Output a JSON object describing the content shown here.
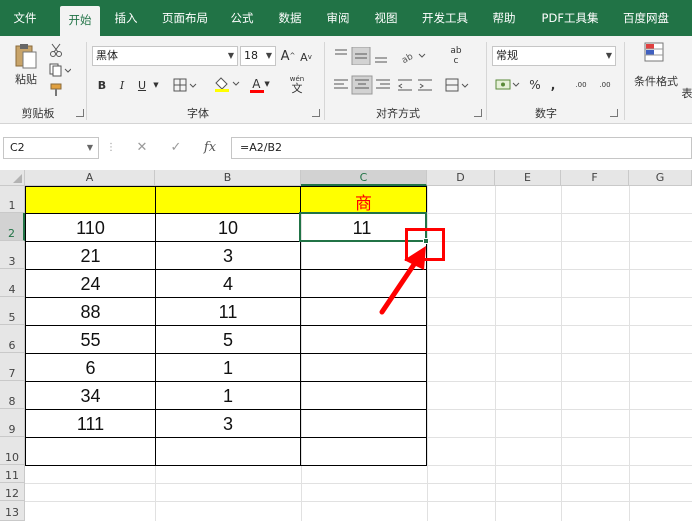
{
  "ribbon_tabs": [
    "文件",
    "开始",
    "插入",
    "页面布局",
    "公式",
    "数据",
    "审阅",
    "视图",
    "开发工具",
    "帮助",
    "PDF工具集",
    "百度网盘"
  ],
  "clipboard": {
    "paste_label": "粘贴",
    "group_label": "剪贴板"
  },
  "font": {
    "font_name": "黑体",
    "font_size": "18",
    "bold": "B",
    "italic": "I",
    "underline": "U",
    "grow": "A",
    "shrink": "A",
    "color_a": "A",
    "wen": "wén",
    "wen_char": "文",
    "group_label": "字体"
  },
  "alignment": {
    "group_label": "对齐方式",
    "ab": "ab",
    "c": "c"
  },
  "number": {
    "format": "常规",
    "percent": "%",
    "comma": ",",
    "inc": ".00",
    "dec": ".00",
    "group_label": "数字"
  },
  "styles": {
    "conditional_label": "条件格式",
    "table_label": "表"
  },
  "formula_bar": {
    "name_box": "C2",
    "formula": "=A2/B2",
    "fx": "fx"
  },
  "grid": {
    "columns": [
      "A",
      "B",
      "C",
      "D",
      "E",
      "F",
      "G"
    ],
    "rows": [
      "1",
      "2",
      "3",
      "4",
      "5",
      "6",
      "7",
      "8",
      "9",
      "10",
      "11",
      "12",
      "13"
    ],
    "header_c1": "商",
    "colA": [
      "110",
      "21",
      "24",
      "88",
      "55",
      "6",
      "34",
      "111"
    ],
    "colB": [
      "10",
      "3",
      "4",
      "11",
      "5",
      "1",
      "1",
      "3"
    ],
    "c2": "11"
  },
  "colors": {
    "excel_green": "#217346",
    "header_yellow": "#ffff00",
    "highlight_red": "#ff0000"
  }
}
